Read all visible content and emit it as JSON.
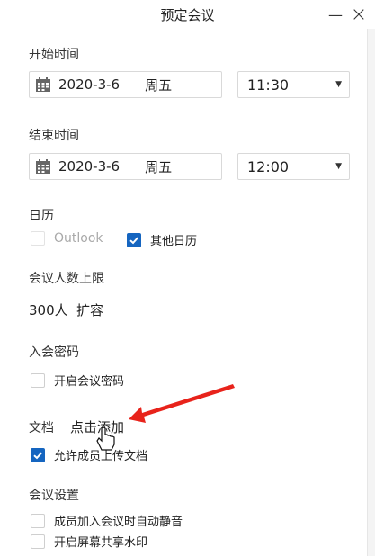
{
  "window": {
    "title": "预定会议",
    "minimize_glyph": "—",
    "close_glyph": "×"
  },
  "start": {
    "label": "开始时间",
    "date": "2020-3-6",
    "weekday": "周五",
    "time": "11:30"
  },
  "end": {
    "label": "结束时间",
    "date": "2020-3-6",
    "weekday": "周五",
    "time": "12:00"
  },
  "calendar": {
    "label": "日历",
    "options": [
      {
        "label": "Outlook",
        "checked": false,
        "disabled": true
      },
      {
        "label": "其他日历",
        "checked": true,
        "disabled": false
      }
    ]
  },
  "capacity": {
    "label": "会议人数上限",
    "value": "300人",
    "expand_link": "扩容"
  },
  "password": {
    "label": "入会密码",
    "enable_label": "开启会议密码",
    "enabled": false
  },
  "documents": {
    "label": "文档",
    "add_link": "点击添加",
    "allow_upload_label": "允许成员上传文档",
    "allow_upload": true
  },
  "settings": {
    "label": "会议设置",
    "options": [
      {
        "label": "成员加入会议时自动静音",
        "checked": false
      },
      {
        "label": "开启屏幕共享水印",
        "checked": false
      }
    ]
  },
  "annotation": {
    "arrow_color": "#e8231b"
  },
  "colors": {
    "accent": "#1565c0",
    "link": "#1a6fc8"
  }
}
